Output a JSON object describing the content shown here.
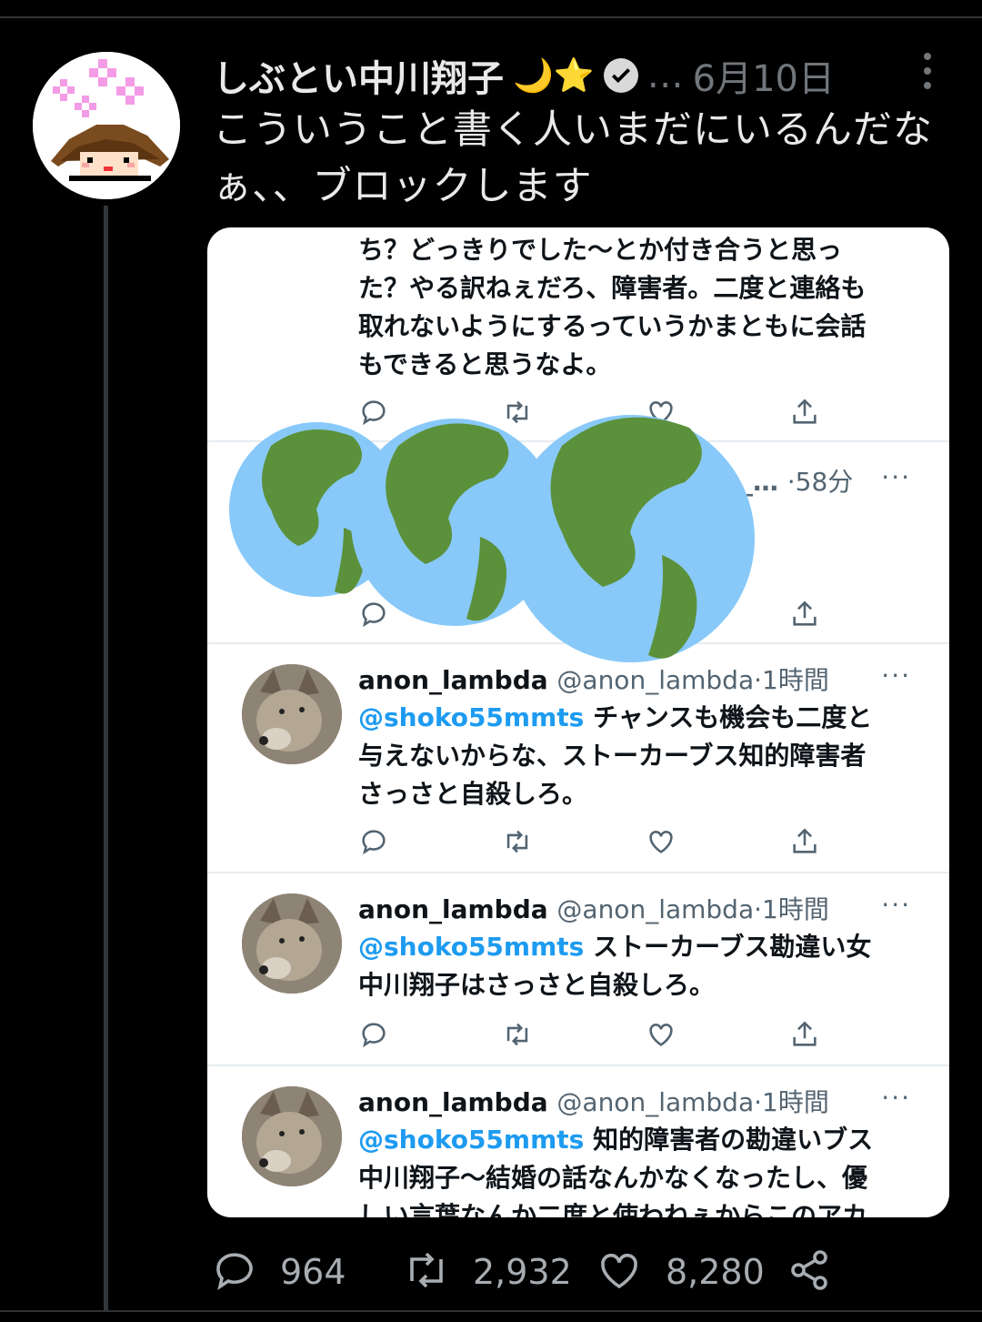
{
  "tweet": {
    "author": "しぶとい中川翔子",
    "name_emojis": "🌙⭐",
    "handle_ellipsis": "…",
    "date": "6月10日",
    "text_line1": "こういうこと書く人いまだにいるんだな",
    "text_line2": "ぁ、、ブロックします",
    "stats": {
      "replies": "964",
      "retweets": "2,932",
      "likes": "8,280"
    }
  },
  "screenshot": {
    "top_tweet": {
      "lines": [
        "ち？どっきりでした〜とか付き合うと思っ",
        "た？やる訳ねぇだろ、障害者。二度と連絡も",
        "取れないようにするっていうかまともに会話",
        "もできると思うなよ。"
      ]
    },
    "second_tweet": {
      "name_tail": "_…",
      "time": "·58分",
      "more": "···"
    },
    "replies": [
      {
        "name": "anon_lambda",
        "handle": "@anon_lambda",
        "time": "·1時間",
        "more": "···",
        "mention": "@shoko55mmts",
        "line1": "チャンスも機会も二度と",
        "line2": "与えないからな、ストーカーブス知的障害者",
        "line3": "さっさと自殺しろ。"
      },
      {
        "name": "anon_lambda",
        "handle": "@anon_lambda",
        "time": "·1時間",
        "more": "···",
        "mention": "@shoko55mmts",
        "line1": "ストーカーブス勘違い女",
        "line2": "中川翔子はさっさと自殺しろ。"
      },
      {
        "name": "anon_lambda",
        "handle": "@anon_lambda",
        "time": "·1時間",
        "more": "···",
        "mention": "@shoko55mmts",
        "line1": "知的障害者の勘違いブス",
        "line2": "中川翔子〜結婚の話なんかなくなったし、優",
        "line3": "しい言葉なんか二度と使わねぇからこのアカ"
      }
    ]
  },
  "colors": {
    "background": "#000000",
    "muted": "#71767b",
    "link": "#1d9bf0",
    "globe_water": "#88c9f9",
    "globe_land": "#5c913b"
  },
  "icons": [
    "verified-badge-icon",
    "more-icon",
    "reply-icon",
    "retweet-icon",
    "like-icon",
    "share-icon",
    "globe-icon"
  ]
}
